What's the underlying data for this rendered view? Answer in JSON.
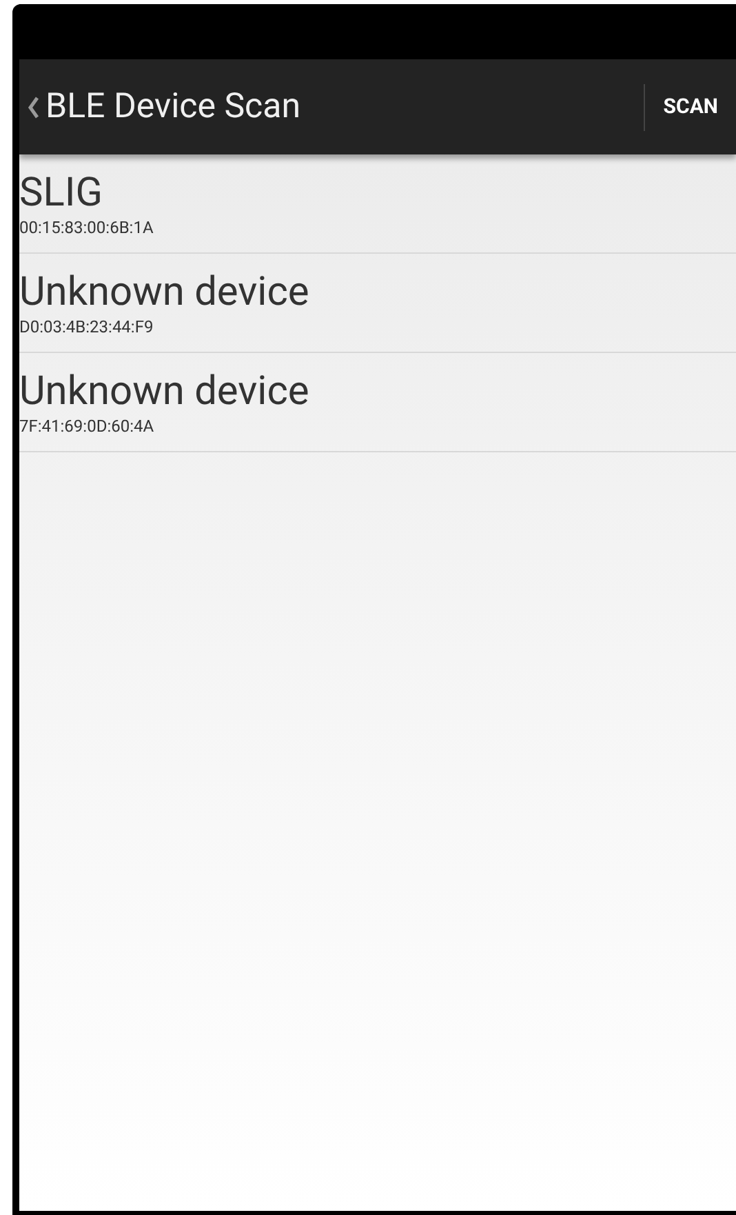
{
  "action_bar": {
    "title": "BLE Device Scan",
    "action": "SCAN"
  },
  "devices": [
    {
      "name": "SLIG",
      "address": "00:15:83:00:6B:1A"
    },
    {
      "name": "Unknown device",
      "address": "D0:03:4B:23:44:F9"
    },
    {
      "name": "Unknown device",
      "address": "7F:41:69:0D:60:4A"
    }
  ]
}
